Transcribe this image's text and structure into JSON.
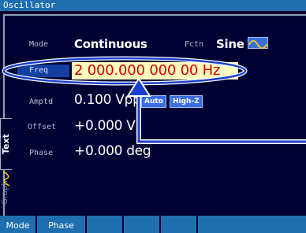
{
  "window": {
    "title": "Oscillator"
  },
  "params": {
    "mode": {
      "label": "Mode",
      "value": "Continuous"
    },
    "fctn": {
      "label": "Fctn",
      "value": "Sine",
      "icon": "sine-wave-icon"
    },
    "freq": {
      "label": "Freq",
      "value": "2 000.000 000 00 Hz"
    },
    "amptd": {
      "label": "Amptd",
      "value": "0.100 Vpp",
      "badges": [
        "Auto",
        "High-Z"
      ]
    },
    "offset": {
      "label": "Offset",
      "value": "+0.000 V"
    },
    "phase": {
      "label": "Phase",
      "value": "+0.000 deg"
    }
  },
  "side_tabs": [
    "Text",
    "Graph"
  ],
  "softkeys": [
    "Mode",
    "Phase",
    "",
    "",
    "",
    ""
  ],
  "colors": {
    "title_bar": "#1f6fb0",
    "background": "#000033",
    "freq_text": "#d40000",
    "freq_field": "#ffffc0",
    "annotation": "#1a3fd0"
  }
}
